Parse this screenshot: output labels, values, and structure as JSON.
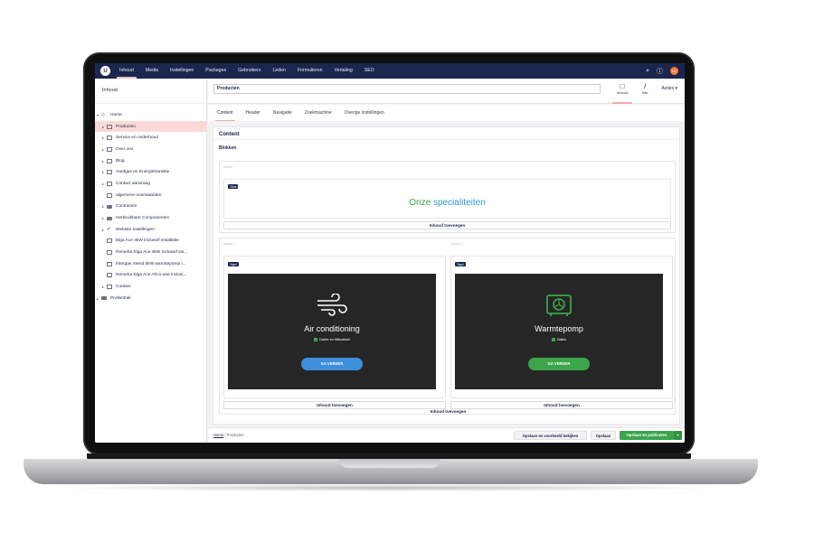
{
  "topnav": {
    "logo": "U",
    "items": [
      "Inhoud",
      "Media",
      "Instellingen",
      "Packages",
      "Gebruikers",
      "Leden",
      "Formulieren",
      "Vertaling",
      "SEO"
    ],
    "avatar_initials": "LC"
  },
  "sidebar": {
    "heading": "Inhoud",
    "tree": [
      {
        "label": "Home",
        "icon": "home-icon"
      },
      {
        "label": "Producten",
        "icon": "page-icon"
      },
      {
        "label": "Service en onderhoud",
        "icon": "page-icon"
      },
      {
        "label": "Over ons",
        "icon": "page-icon"
      },
      {
        "label": "Blog",
        "icon": "page-icon"
      },
      {
        "label": "Aardgas en Energietransitie",
        "icon": "page-icon"
      },
      {
        "label": "Contact aanvraag",
        "icon": "page-icon"
      },
      {
        "label": "algemene-voorwaarden",
        "icon": "page-icon"
      },
      {
        "label": "Contracten",
        "icon": "folder-icon"
      },
      {
        "label": "Herbruikbare Componenten",
        "icon": "database-icon"
      },
      {
        "label": "Website Instellingen",
        "icon": "settings-icon"
      },
      {
        "label": "Elga Ace 4kW inclusief installatie",
        "icon": "page-icon"
      },
      {
        "label": "Remeha Elga Ace 4kW inclusief ins...",
        "icon": "page-icon"
      },
      {
        "label": "Intergas Xtend 5kW warmtepomp i...",
        "icon": "page-icon"
      },
      {
        "label": "Remeha Elga Ace All-in-one inclusi...",
        "icon": "page-icon"
      },
      {
        "label": "Contact",
        "icon": "page-icon"
      },
      {
        "label": "Prullenbak",
        "icon": "trash-icon"
      }
    ]
  },
  "header": {
    "node_name": "Producten",
    "inhoud_label": "Inhoud",
    "info_label": "Info",
    "acties_label": "Acties"
  },
  "tabs": [
    "Content",
    "Header",
    "Navigatie",
    "Zoekmachine",
    "Overige instellingen"
  ],
  "content": {
    "title": "Content",
    "blokken_label": "Blokken",
    "kolom_label": "Kolom",
    "kolom1_label": "Kolom 1",
    "kolom2_label": "Kolom 2",
    "tekst_tag": "Tekst",
    "tegel_tag": "Tegel",
    "special_part1": "Onze",
    "special_part2": "specialiteiten",
    "add_label": "Inhoud toevoegen",
    "tiles": [
      {
        "title": "Air conditioning",
        "subtitle": "Daikin en Mitsubishi",
        "button": "GA VERDER",
        "button_color": "#3d8fdc"
      },
      {
        "title": "Warmtepomp",
        "subtitle": "Daikin",
        "button": "GA VERDER",
        "button_color": "#3aa54b"
      }
    ]
  },
  "footer": {
    "crumb_home": "Home",
    "crumb_current": "Producten",
    "btn_preview": "Opslaan en voorbeeld bekijken",
    "btn_save": "Opslaan",
    "btn_publish": "Opslaan en publiceren"
  },
  "colors": {
    "nav_bg": "#1b264f",
    "accent_pink": "#f5a9a2",
    "green": "#3aa54b",
    "blue": "#3d8fdc"
  }
}
